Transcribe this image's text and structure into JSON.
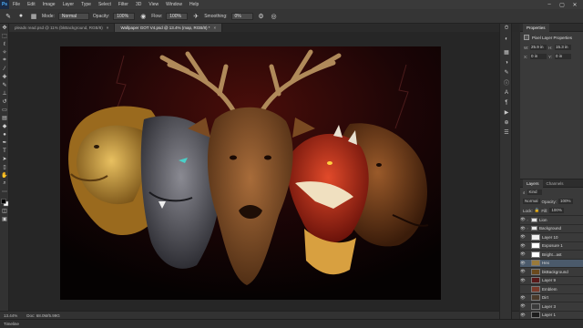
{
  "menubar": {
    "app_icon": "Ps",
    "items": [
      "File",
      "Edit",
      "Image",
      "Layer",
      "Type",
      "Select",
      "Filter",
      "3D",
      "View",
      "Window",
      "Help"
    ],
    "window_controls": [
      "minimize-icon",
      "maximize-icon",
      "close-icon"
    ]
  },
  "options_bar": {
    "mode_label": "Mode:",
    "mode_value": "Normal",
    "opacity_label": "Opacity:",
    "opacity_value": "100%",
    "flow_label": "Flow:",
    "flow_value": "100%",
    "smoothing_label": "Smoothing:",
    "smoothing_value": "0%",
    "icons": [
      "brush-tool-icon",
      "brush-preset-icon",
      "brush-panel-icon",
      "pressure-opacity-icon",
      "airbrush-icon",
      "gear-icon",
      "pressure-size-icon"
    ]
  },
  "tabs": [
    {
      "label": "pleads read.psd @ 11% (bkBackground, RGB/8)",
      "active": false
    },
    {
      "label": "Wallpaper GOT V4.psd @ 13.4% (map, RGB/8) *",
      "active": true
    }
  ],
  "status": {
    "zoom": "13.44%",
    "doc_size": "Doc: 68.0M/5.99G"
  },
  "timeline_label": "Timeline",
  "properties": {
    "tabs": [
      "Properties"
    ],
    "title": "Pixel Layer Properties",
    "w_label": "W:",
    "w_value": "25.9 in",
    "h_label": "H:",
    "h_value": "15.3 in",
    "x_label": "X:",
    "x_value": "0 in",
    "y_label": "Y:",
    "y_value": "0 in"
  },
  "layers_panel": {
    "tabs": [
      "Layers",
      "Channels"
    ],
    "filter_label": "Kind",
    "blend_mode": "Normal",
    "opacity_label": "Opacity:",
    "opacity_value": "100%",
    "lock_label": "Lock:",
    "fill_label": "Fill:",
    "fill_value": "100%",
    "layers": [
      {
        "name": "Lion",
        "visible": true,
        "group": true,
        "selected": false,
        "thumb_color": "#e6e6e6"
      },
      {
        "name": "Background",
        "visible": true,
        "group": true,
        "selected": false,
        "thumb_color": "#e6e6e6"
      },
      {
        "name": "Layer 10",
        "visible": true,
        "group": false,
        "selected": false,
        "thumb_color": "#f0f0f0"
      },
      {
        "name": "Exposure 1",
        "visible": true,
        "group": false,
        "selected": false,
        "thumb_color": "#ffffff"
      },
      {
        "name": "Bright...ast",
        "visible": true,
        "group": false,
        "selected": false,
        "thumb_color": "#ffffff"
      },
      {
        "name": "Hex",
        "visible": true,
        "group": false,
        "selected": true,
        "thumb_color": "#9a7a3a"
      },
      {
        "name": "bkBackground",
        "visible": true,
        "group": false,
        "selected": false,
        "thumb_color": "#6b4a1e"
      },
      {
        "name": "Layer 9",
        "visible": true,
        "group": false,
        "selected": false,
        "thumb_color": "#5a1a1a"
      },
      {
        "name": "Emblem",
        "visible": false,
        "group": false,
        "selected": false,
        "thumb_color": "#7a3a2a"
      },
      {
        "name": "Dirt",
        "visible": true,
        "group": false,
        "selected": false,
        "thumb_color": "#4a3a2a"
      },
      {
        "name": "Layer 3",
        "visible": true,
        "group": false,
        "selected": false,
        "thumb_color": "#3a3a3a"
      },
      {
        "name": "Layer 1",
        "visible": true,
        "group": false,
        "selected": false,
        "thumb_color": "#1e1e1e"
      }
    ]
  },
  "colors": {
    "canvas_background": "#090303",
    "selected_layer": "#4b5a6b",
    "accent": "#4db0ff"
  }
}
